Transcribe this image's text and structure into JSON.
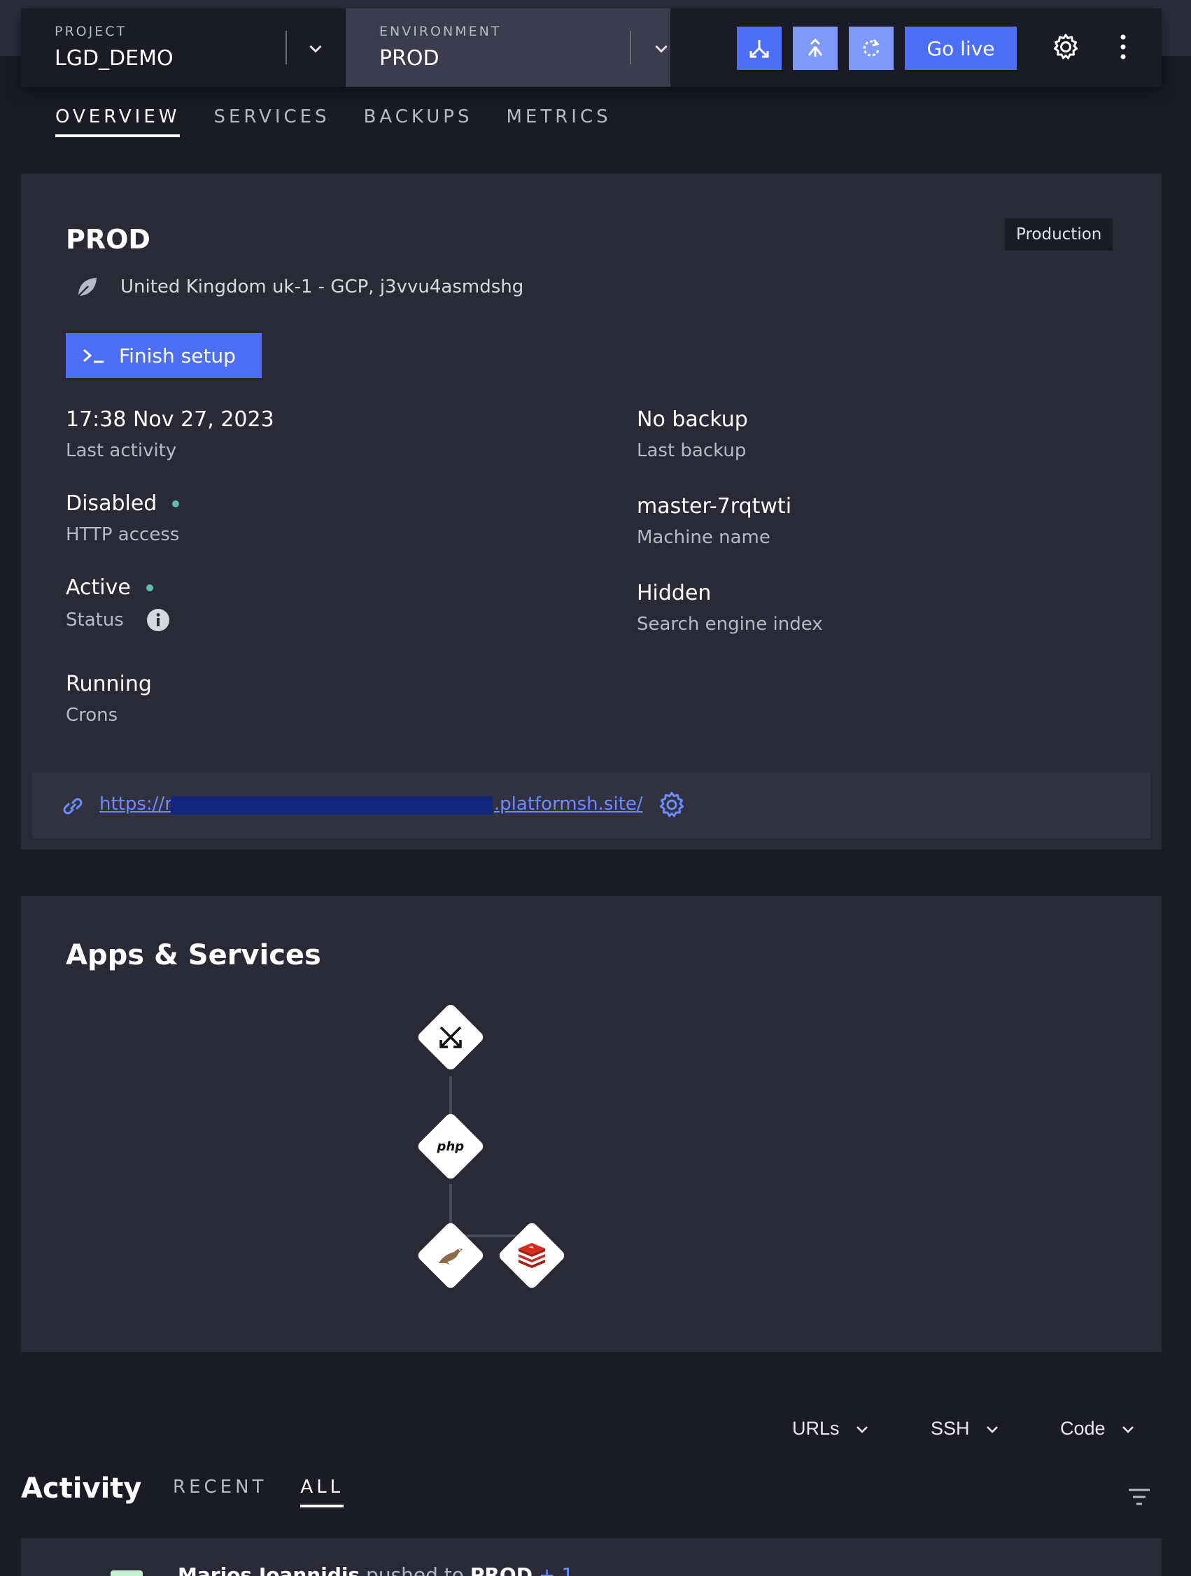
{
  "header": {
    "project": {
      "label": "PROJECT",
      "value": "LGD_DEMO"
    },
    "environment": {
      "label": "ENVIRONMENT",
      "value": "PROD"
    },
    "go_live_label": "Go live"
  },
  "tabs": [
    {
      "label": "OVERVIEW",
      "active": true
    },
    {
      "label": "SERVICES",
      "active": false
    },
    {
      "label": "BACKUPS",
      "active": false
    },
    {
      "label": "METRICS",
      "active": false
    }
  ],
  "environment_panel": {
    "title": "PROD",
    "badge": "Production",
    "region": "United Kingdom uk-1 - GCP, j3vvu4asmdshg",
    "finish_setup_label": "Finish setup",
    "info_left": [
      {
        "value": "17:38 Nov 27, 2023",
        "key": "Last activity"
      },
      {
        "value": "Disabled",
        "key": "HTTP access"
      },
      {
        "value": "Active",
        "key": "Status"
      },
      {
        "value": "Running",
        "key": "Crons"
      }
    ],
    "info_right": [
      {
        "value": "No backup",
        "key": "Last backup"
      },
      {
        "value": "master-7rqtwti",
        "key": "Machine name"
      },
      {
        "value": "Hidden",
        "key": "Search engine index"
      }
    ],
    "url_prefix": "https://r",
    "url_suffix": ".platformsh.site/"
  },
  "apps": {
    "title": "Apps & Services",
    "php_label": "php"
  },
  "bottom": {
    "dropdowns": [
      "URLs",
      "SSH",
      "Code"
    ],
    "activity_title": "Activity",
    "activity_tabs": [
      {
        "label": "RECENT",
        "active": false
      },
      {
        "label": "ALL",
        "active": true
      }
    ],
    "first_item": {
      "user": "Marios Ioannidis",
      "action": "pushed to",
      "target": "PROD",
      "more": "+ 1"
    }
  },
  "colors": {
    "accent": "#4c6ff6",
    "accent_light": "#7f99f8",
    "link": "#6b8cff",
    "status_dot": "#5fb8b0",
    "panel_bg": "#292938",
    "page_bg": "#1b1b28"
  }
}
